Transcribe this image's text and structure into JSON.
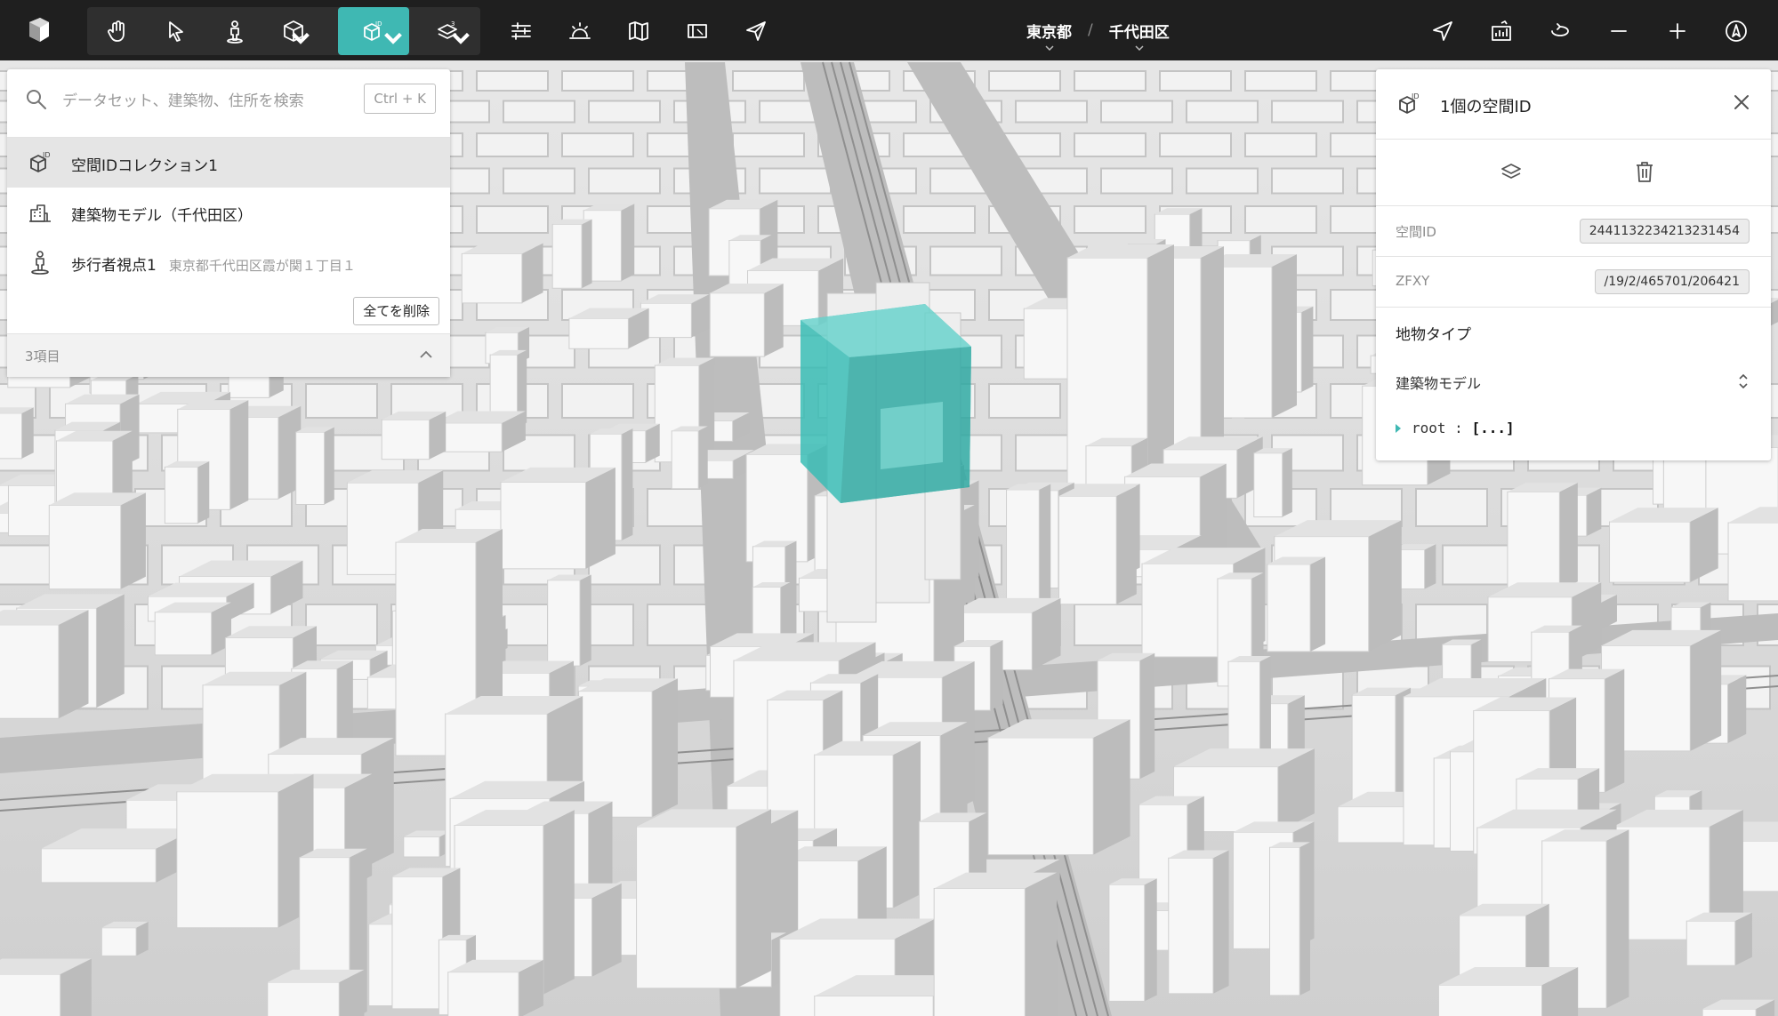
{
  "toolbar": {
    "logo": "app-logo-icon",
    "tools": [
      {
        "name": "hand-icon"
      },
      {
        "name": "pointer-icon"
      },
      {
        "name": "pedestrian-icon"
      },
      {
        "name": "cube-icon"
      },
      {
        "name": "spatial-id-icon",
        "active": true
      },
      {
        "name": "layers-3d-icon"
      },
      {
        "name": "sliders-icon"
      },
      {
        "name": "sun-icon"
      },
      {
        "name": "map-icon"
      },
      {
        "name": "clipping-icon"
      },
      {
        "name": "share-icon"
      }
    ],
    "right_tools": [
      {
        "name": "location-icon"
      },
      {
        "name": "chart-icon"
      },
      {
        "name": "rotate-icon"
      },
      {
        "name": "zoom-out-icon"
      },
      {
        "name": "zoom-in-icon"
      },
      {
        "name": "compass-icon"
      }
    ],
    "accent": "#3fb8b3"
  },
  "breadcrumb": {
    "prefecture": "東京都",
    "separator": "/",
    "ward": "千代田区"
  },
  "search": {
    "placeholder": "データセット、建築物、住所を検索",
    "shortcut": "Ctrl + K"
  },
  "datasets": {
    "items": [
      {
        "label": "空間IDコレクション1",
        "icon": "spatial-id-icon",
        "selected": true
      },
      {
        "label": "建築物モデル（千代田区）",
        "icon": "building-icon"
      },
      {
        "label": "歩行者視点1",
        "sub": "東京都千代田区霞が関１丁目１",
        "icon": "pedestrian-icon"
      }
    ],
    "clear_label": "全てを削除",
    "count": "3項目"
  },
  "inspector": {
    "title": "1個の空間ID",
    "props": [
      {
        "key": "空間ID",
        "value": "2441132234213231454"
      },
      {
        "key": "ZFXY",
        "value": "/19/2/465701/206421"
      }
    ],
    "feature_type_label": "地物タイプ",
    "feature_type_value": "建築物モデル",
    "tree_key": "root",
    "tree_value": "[...]"
  }
}
